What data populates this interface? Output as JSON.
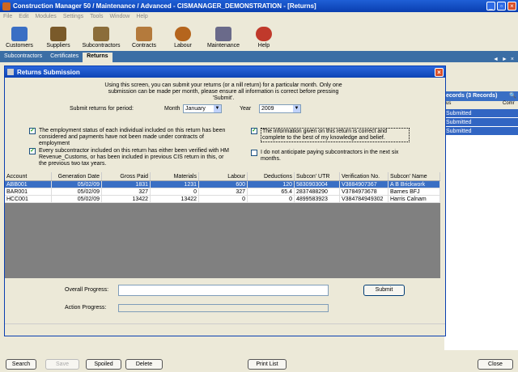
{
  "window": {
    "title": "Construction Manager 50 / Maintenance / Advanced  -  CISMANAGER_DEMONSTRATION - [Returns]"
  },
  "menu": [
    "File",
    "Edit",
    "Modules",
    "Settings",
    "Tools",
    "Window",
    "Help"
  ],
  "toolbar": [
    {
      "label": "Customers",
      "color": "#3a6fc4"
    },
    {
      "label": "Suppliers",
      "color": "#7a5a2a"
    },
    {
      "label": "Subcontractors",
      "color": "#8b6d3a"
    },
    {
      "label": "Contracts",
      "color": "#b47a3c"
    },
    {
      "label": "Labour",
      "color": "#b5651d"
    },
    {
      "label": "Maintenance",
      "color": "#6a6a8a"
    },
    {
      "label": "Help",
      "color": "#c0392b"
    }
  ],
  "tabs": [
    "Subcontractors",
    "Certificates",
    "Returns"
  ],
  "right_panel": {
    "header": "ecords (3 Records)",
    "col1": "us",
    "col2": "Comr",
    "rows": [
      "Submitted",
      "Submitted",
      "Submitted"
    ]
  },
  "dialog": {
    "title": "Returns Submission",
    "intro": "Using this screen, you can submit your returns (or a nill return) for a particular month.  Only one submission can be made per month, please ensure all information is correct before pressing 'Submit'.",
    "period_label": "Submit returns for period:",
    "month_label": "Month",
    "month_value": "January",
    "year_label": "Year",
    "year_value": "2009",
    "checks": [
      {
        "text": "The employment status of each individual included on this return has been considered and payments have not been made under contracts of employment",
        "checked": true
      },
      {
        "text": "Every subcontractor included on this return has either been verified with HM Revenue_Customs, or has been included in previous CIS return in this, or the previous two tax years.",
        "checked": true
      },
      {
        "text": "The information given on this return is correct and complete to the best of my knowledge and belief.",
        "checked": true
      },
      {
        "text": "I do not anticipate paying subcontractors in the next six months.",
        "checked": false
      }
    ],
    "grid": {
      "headers": [
        "Account",
        "Generation Date",
        "Gross Paid",
        "Materials",
        "Labour",
        "Deductions",
        "Subcon' UTR",
        "Verification No.",
        "Subcon' Name"
      ],
      "rows": [
        [
          "ABB001",
          "05/02/09",
          "1831",
          "1231",
          "600",
          "120",
          "5830903004",
          "V3884907367",
          "A B Brickwork"
        ],
        [
          "BAR001",
          "05/02/09",
          "327",
          "0",
          "327",
          "65.4",
          "2837488290",
          "V3784973678",
          "Barnes BFJ"
        ],
        [
          "HCC001",
          "05/02/09",
          "13422",
          "13422",
          "0",
          "0",
          "4899583923",
          "V384784949302",
          "Harris Calnam"
        ]
      ]
    },
    "overall_progress_label": "Overall Progress:",
    "action_progress_label": "Action Progress:",
    "submit_label": "Submit"
  },
  "bottom_buttons": {
    "search": "Search",
    "save": "Save",
    "spoiled": "Spoiled",
    "delete": "Delete",
    "print_list": "Print List",
    "close": "Close"
  }
}
